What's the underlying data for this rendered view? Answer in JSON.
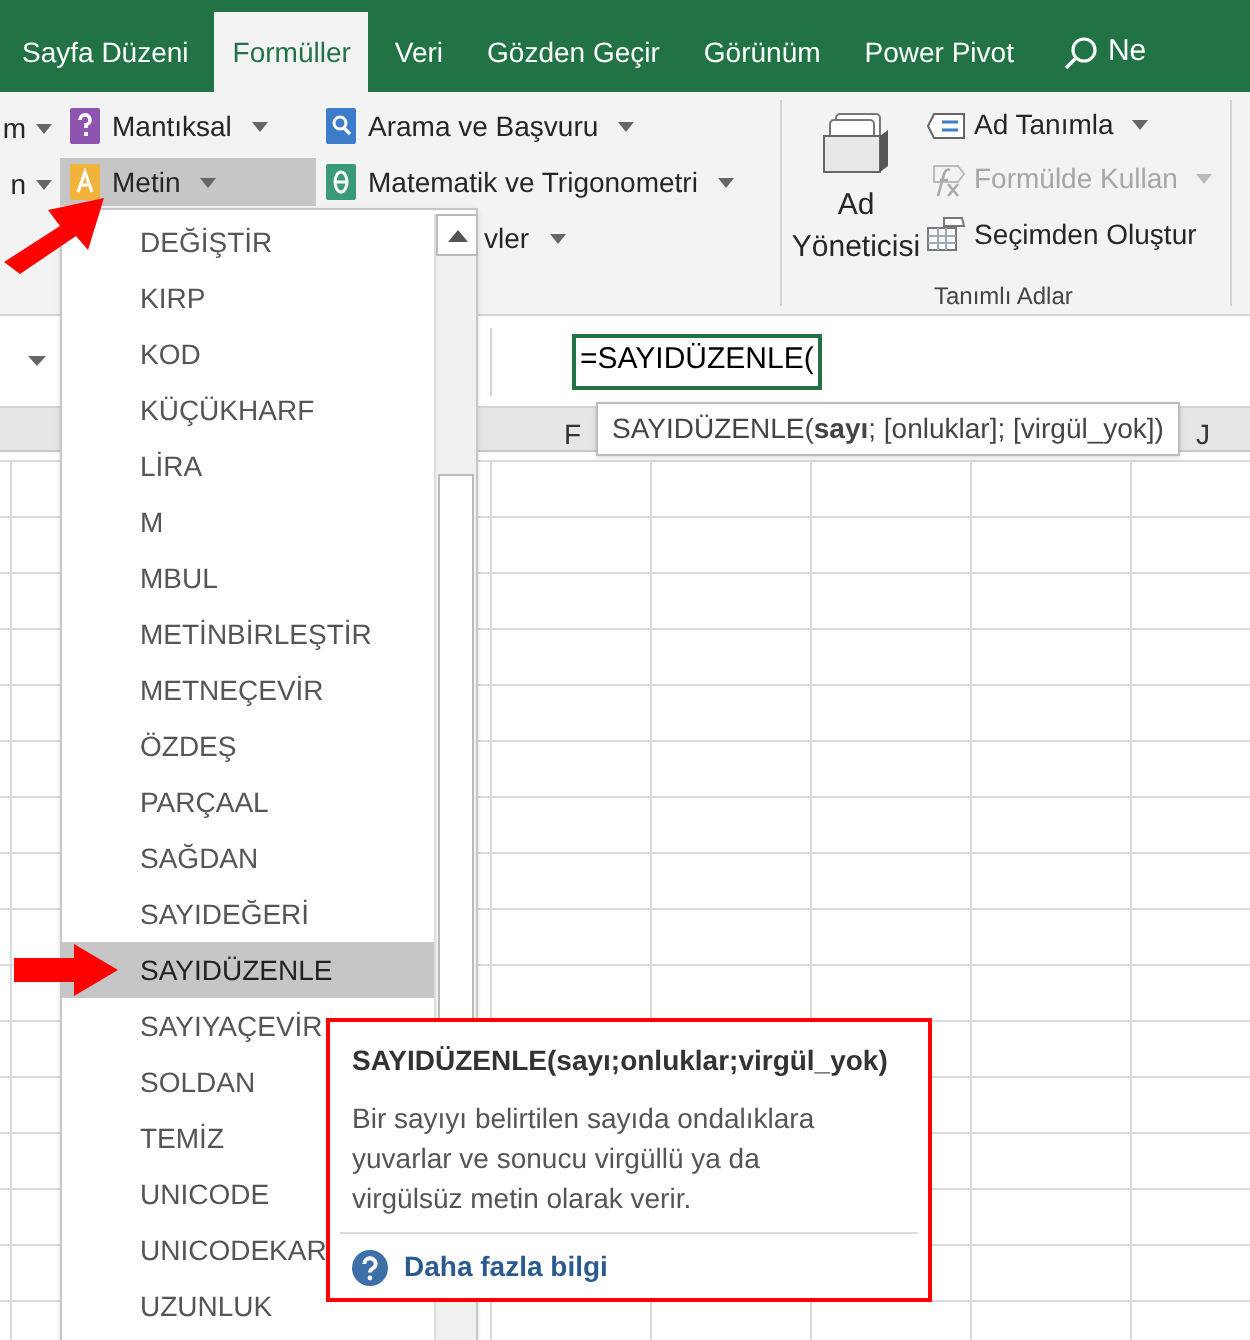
{
  "tabs": [
    {
      "label": "Sayfa Düzeni",
      "selected": false
    },
    {
      "label": "Formüller",
      "selected": true
    },
    {
      "label": "Veri",
      "selected": false
    },
    {
      "label": "Gözden Geçir",
      "selected": false
    },
    {
      "label": "Görünüm",
      "selected": false
    },
    {
      "label": "Power Pivot",
      "selected": false
    }
  ],
  "search": {
    "label": "Ne"
  },
  "ribbon": {
    "left_cut": [
      "m",
      "n"
    ],
    "function_buttons": [
      {
        "label": "Mantıksal",
        "selected": false
      },
      {
        "label": "Metin",
        "selected": true
      },
      {
        "label": "Arama ve Başvuru",
        "selected": false
      },
      {
        "label": "Matematik ve Trigonometri",
        "selected": false
      },
      {
        "label": "vler",
        "selected": false
      }
    ],
    "name_manager": {
      "label": "Ad Yöneticisi"
    },
    "name_commands": [
      {
        "label": "Ad Tanımla",
        "disabled": false
      },
      {
        "label": "Formülde Kullan",
        "disabled": true
      },
      {
        "label": "Seçimden Oluştur",
        "disabled": false
      }
    ],
    "group_label": "Tanımlı Adlar"
  },
  "formula": {
    "value": "=SAYIDÜZENLE(",
    "hint": "SAYIDÜZENLE(**sayı**; [onluklar]; [virgül_yok])"
  },
  "column_headers": [
    "F",
    "J"
  ],
  "menu": {
    "items": [
      {
        "label": "DEĞİŞTİR",
        "selected": false
      },
      {
        "label": "KIRP",
        "selected": false
      },
      {
        "label": "KOD",
        "selected": false
      },
      {
        "label": "KÜÇÜKHARF",
        "selected": false
      },
      {
        "label": "LİRA",
        "selected": false
      },
      {
        "label": "M",
        "selected": false
      },
      {
        "label": "MBUL",
        "selected": false
      },
      {
        "label": "METİNBİRLEŞTİR",
        "selected": false
      },
      {
        "label": "METNEÇEVİR",
        "selected": false
      },
      {
        "label": "ÖZDEŞ",
        "selected": false
      },
      {
        "label": "PARÇAAL",
        "selected": false
      },
      {
        "label": "SAĞDAN",
        "selected": false
      },
      {
        "label": "SAYIDEĞERİ",
        "selected": false
      },
      {
        "label": "SAYIDÜZENLE",
        "selected": true
      },
      {
        "label": "SAYIYAÇEVİR",
        "selected": false
      },
      {
        "label": "SOLDAN",
        "selected": false
      },
      {
        "label": "TEMİZ",
        "selected": false
      },
      {
        "label": "UNICODE",
        "selected": false
      },
      {
        "label": "UNICODEKAR",
        "selected": false
      },
      {
        "label": "UZUNLUK",
        "selected": false
      }
    ]
  },
  "tooltip": {
    "title": "SAYIDÜZENLE(sayı;onluklar;virgül_yok)",
    "description": "Bir sayıyı belirtilen sayıda ondalıklara yuvarlar ve sonucu virgüllü ya da virgülsüz metin olarak verir.",
    "link": "Daha fazla bilgi"
  }
}
